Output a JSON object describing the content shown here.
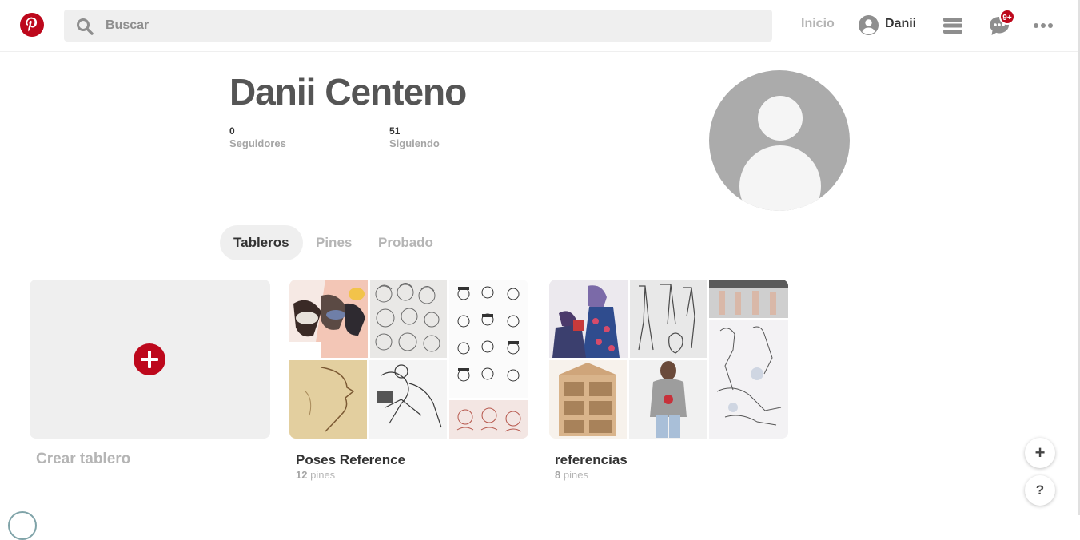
{
  "header": {
    "search_placeholder": "Buscar",
    "home_label": "Inicio",
    "user_name": "Danii",
    "notification_badge": "9+",
    "brand_color": "#bd081c"
  },
  "profile": {
    "full_name": "Danii Centeno",
    "followers_count": "0",
    "followers_label": "Seguidores",
    "following_count": "51",
    "following_label": "Siguiendo"
  },
  "tabs": [
    {
      "label": "Tableros",
      "active": true
    },
    {
      "label": "Pines",
      "active": false
    },
    {
      "label": "Probado",
      "active": false
    }
  ],
  "create_board": {
    "label": "Crear tablero"
  },
  "boards": [
    {
      "title": "Poses Reference",
      "count": "12",
      "unit": "pines"
    },
    {
      "title": "referencias",
      "count": "8",
      "unit": "pines"
    }
  ],
  "fab": {
    "add": "+",
    "help": "?"
  }
}
